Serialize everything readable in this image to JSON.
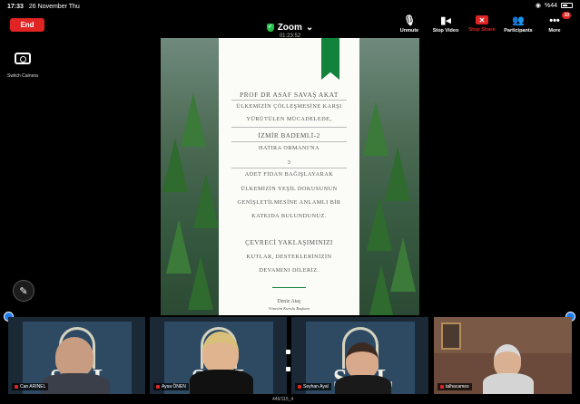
{
  "status_bar": {
    "time": "17:33",
    "date": "26 November Thu",
    "battery": "%44"
  },
  "meeting": {
    "end_label": "End",
    "app_title": "Zoom",
    "elapsed": "01:23:52"
  },
  "toolbar": {
    "items": [
      {
        "label": "Unmute",
        "icon": "mic-muted-icon"
      },
      {
        "label": "Stop Video",
        "icon": "video-icon"
      },
      {
        "label": "Stop Share",
        "icon": "share-stop-icon"
      },
      {
        "label": "Participants",
        "icon": "participants-icon"
      },
      {
        "label": "More",
        "icon": "more-icon",
        "badge": "10"
      }
    ]
  },
  "switch_camera_label": "Switch Camera",
  "certificate": {
    "recipient": "PROF DR ASAF SAVAŞ AKAT",
    "line1": "ÜLKEMİZİN ÇÖLLEŞMESİNE KARŞI",
    "line2": "YÜRÜTÜLEN MÜCADELEDE,",
    "place": "İZMİR BADEMLİ-2",
    "forest": "HATIRA ORMANI'NA",
    "count": "3",
    "line3": "ADET FİDAN BAĞIŞLAYARAK",
    "line4": "ÜLKEMİZİN YEŞİL DOKUSUNUN",
    "line5": "GENİŞLETİLMESİNE ANLAMLI BİR",
    "line6": "KATKIDA BULUNDUNUZ.",
    "line7": "ÇEVRECİ YAKLAŞIMINIZI",
    "line8": "KUTLAR, DESTEKLERİNİZİN",
    "line9": "DEVAMINI DİLERİZ.",
    "signer": "Deniz Ataç",
    "signer_title": "Yönetim Kurulu Başkanı"
  },
  "participants": [
    {
      "name": "Can ARINEL"
    },
    {
      "name": "Aysa ÖNEN"
    },
    {
      "name": "Seyhan Ayal"
    },
    {
      "name": "talhacames"
    }
  ],
  "footer_text": "449/115_4",
  "colors": {
    "end_red": "#e02424",
    "accent_blue": "#1d7df0",
    "ribbon_green": "#13823a"
  }
}
